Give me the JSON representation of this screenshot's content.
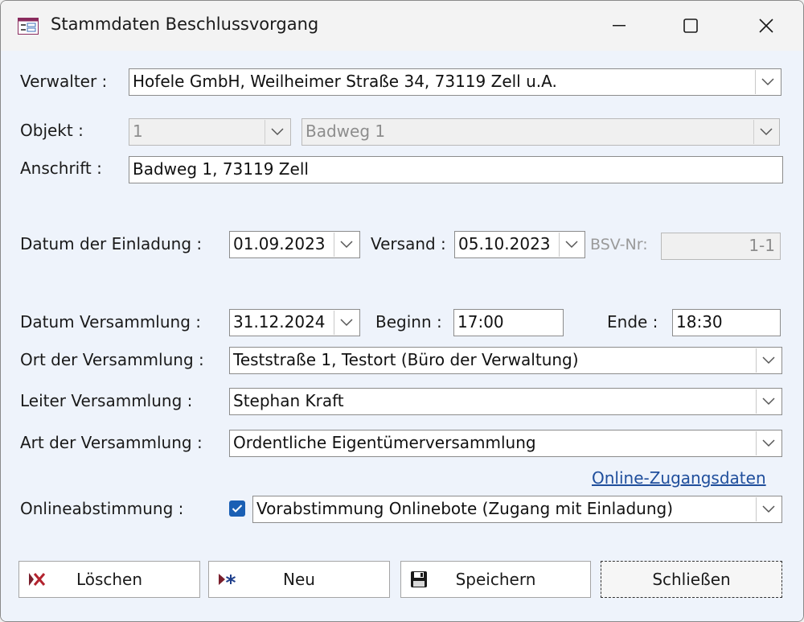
{
  "window": {
    "title": "Stammdaten Beschlussvorgang"
  },
  "labels": {
    "verwalter": "Verwalter :",
    "objekt": "Objekt :",
    "anschrift": "Anschrift :",
    "datum_einladung": "Datum der Einladung :",
    "versand": "Versand :",
    "bsv_nr": "BSV-Nr:",
    "datum_versammlung": "Datum Versammlung :",
    "beginn": "Beginn :",
    "ende": "Ende :",
    "ort": "Ort der Versammlung :",
    "leiter": "Leiter Versammlung :",
    "art": "Art der Versammlung :",
    "onlineabstimmung": "Onlineabstimmung :"
  },
  "fields": {
    "verwalter": "Hofele GmbH, Weilheimer Straße 34, 73119 Zell u.A.",
    "objekt_nr": "1",
    "objekt_name": "Badweg 1",
    "anschrift": "Badweg 1, 73119 Zell",
    "datum_einladung": "01.09.2023",
    "versand": "05.10.2023",
    "bsv_nr": "1-1",
    "datum_versammlung": "31.12.2024",
    "beginn": "17:00",
    "ende": "18:30",
    "ort": "Teststraße 1, Testort (Büro der Verwaltung)",
    "leiter": "Stephan Kraft",
    "art": "Ordentliche Eigentümerversammlung",
    "onlineabstimmung": "Vorabstimmung Onlinebote (Zugang mit Einladung)",
    "onlineabstimmung_checked": true
  },
  "link": {
    "online_zugangsdaten": "Online-Zugangsdaten"
  },
  "buttons": {
    "loeschen": "Löschen",
    "neu": "Neu",
    "speichern": "Speichern",
    "schliessen": "Schließen"
  },
  "icons": {
    "app": "form-icon",
    "minimize": "minimize-icon",
    "maximize": "maximize-icon",
    "close": "close-icon",
    "dropdown": "chevron-down-icon",
    "checkbox": "checkmark-icon",
    "delete": "delete-record-icon",
    "new": "new-record-icon",
    "save": "floppy-disk-icon"
  },
  "colors": {
    "accent": "#1a5fb4",
    "link": "#1f4e9c",
    "content_bg": "#eef3fb"
  }
}
